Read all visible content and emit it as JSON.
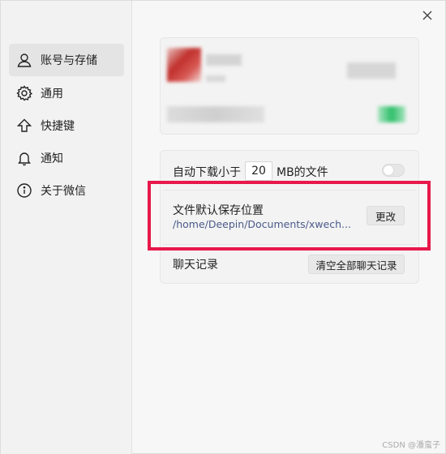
{
  "sidebar": {
    "items": [
      {
        "label": "账号与存储",
        "icon": "person-icon",
        "active": true
      },
      {
        "label": "通用",
        "icon": "gear-icon",
        "active": false
      },
      {
        "label": "快捷键",
        "icon": "arrow-up-icon",
        "active": false
      },
      {
        "label": "通知",
        "icon": "bell-icon",
        "active": false
      },
      {
        "label": "关于微信",
        "icon": "info-icon",
        "active": false
      }
    ]
  },
  "settings": {
    "auto_download_prefix": "自动下载小于",
    "auto_download_value": "20",
    "auto_download_suffix": "MB的文件",
    "auto_download_enabled": false,
    "file_location_label": "文件默认保存位置",
    "file_location_path": "/home/Deepin/Documents/xwech...",
    "change_button": "更改",
    "chat_history_label": "聊天记录",
    "clear_button": "清空全部聊天记录"
  },
  "colors": {
    "highlight": "#e8184a",
    "path": "#4a5a8a",
    "accent_green": "#2fbf6a"
  },
  "watermark": "CSDN @潘蛮子"
}
